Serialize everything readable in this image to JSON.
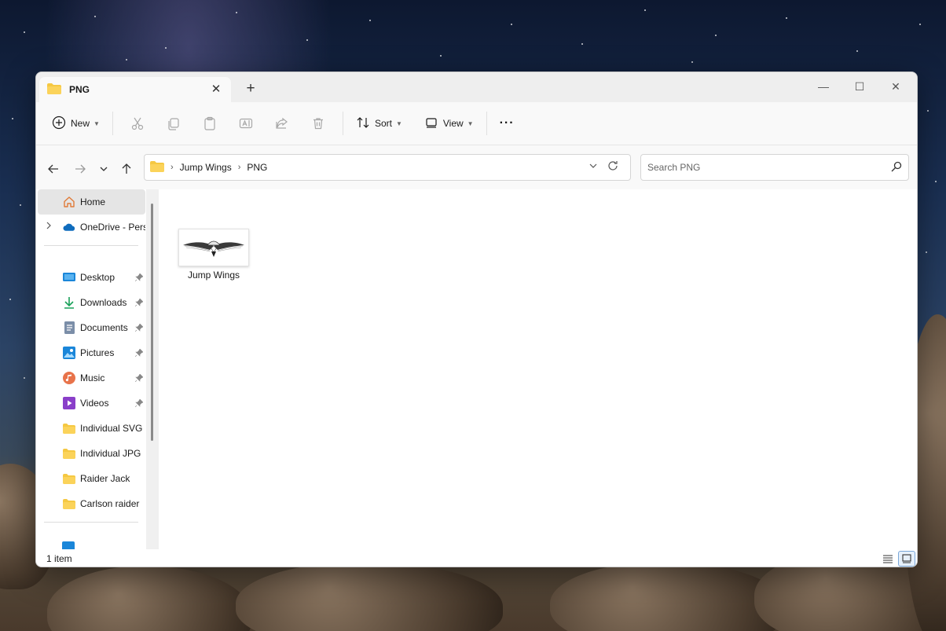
{
  "window": {
    "tab_title": "PNG",
    "new_tab_symbol": "+",
    "close_tab_symbol": "✕",
    "controls": {
      "minimize": "—",
      "maximize": "☐",
      "close": "✕"
    }
  },
  "toolbar": {
    "new_label": "New",
    "sort_label": "Sort",
    "view_label": "View",
    "more_label": "···",
    "icons": [
      "cut-icon",
      "copy-icon",
      "paste-icon",
      "rename-icon",
      "share-icon",
      "delete-icon"
    ]
  },
  "address": {
    "breadcrumbs": [
      "Jump Wings",
      "PNG"
    ],
    "separator": "›"
  },
  "search": {
    "placeholder": "Search PNG"
  },
  "sidebar": {
    "items": [
      {
        "label": "Home",
        "icon": "home-icon",
        "selected": true
      },
      {
        "label": "OneDrive - Personal",
        "icon": "onedrive-icon"
      },
      {
        "label": "Desktop",
        "icon": "desktop-icon",
        "pinned": true
      },
      {
        "label": "Downloads",
        "icon": "downloads-icon",
        "pinned": true
      },
      {
        "label": "Documents",
        "icon": "documents-icon",
        "pinned": true
      },
      {
        "label": "Pictures",
        "icon": "pictures-icon",
        "pinned": true
      },
      {
        "label": "Music",
        "icon": "music-icon",
        "pinned": true
      },
      {
        "label": "Videos",
        "icon": "videos-icon",
        "pinned": true
      },
      {
        "label": "Individual SVG",
        "icon": "folder-icon"
      },
      {
        "label": "Individual JPG",
        "icon": "folder-icon"
      },
      {
        "label": "Raider Jack",
        "icon": "folder-icon"
      },
      {
        "label": "Carlson raider",
        "icon": "folder-icon"
      }
    ]
  },
  "content": {
    "files": [
      {
        "name": "Jump Wings",
        "type": "png"
      }
    ]
  },
  "status": {
    "item_count": "1 item"
  },
  "colors": {
    "folder": "#f5c842",
    "accent": "#0067c0",
    "selected_bg": "#e5e5e5"
  }
}
